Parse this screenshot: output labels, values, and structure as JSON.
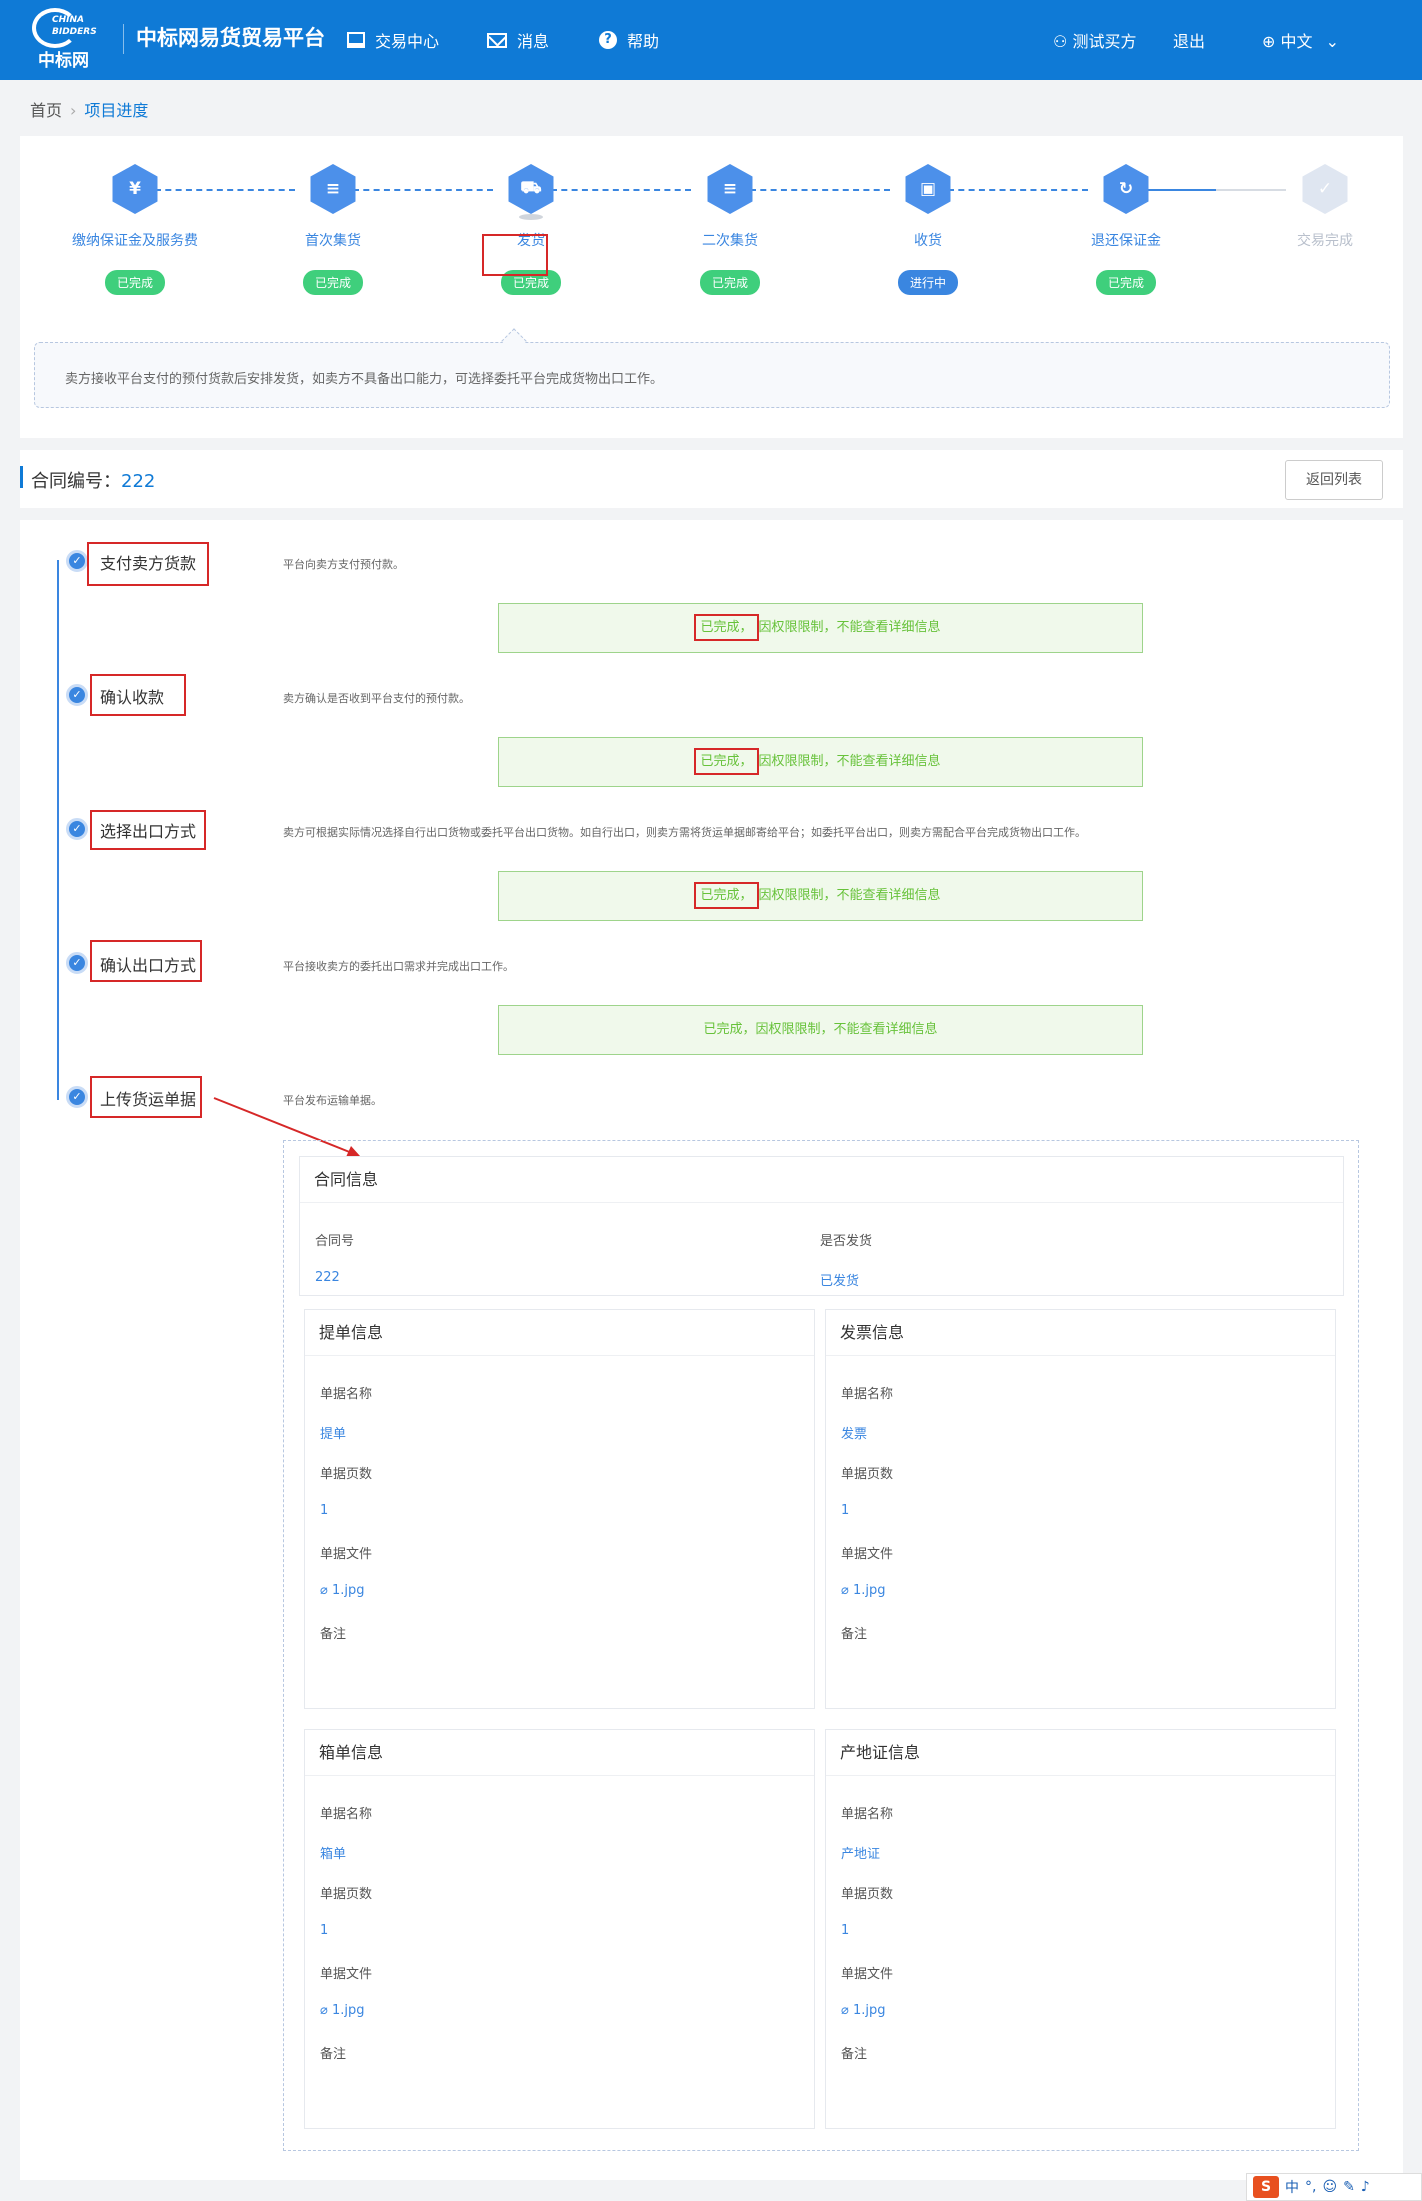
{
  "header": {
    "logo_text_top": "CHINA BIDDERS",
    "logo_text_cn": "中标网",
    "brand": "中标网易货贸易平台",
    "nav": [
      {
        "label": "交易中心",
        "icon": "monitor-icon"
      },
      {
        "label": "消息",
        "icon": "mail-icon"
      },
      {
        "label": "帮助",
        "icon": "help-icon"
      }
    ],
    "user": "测试买方",
    "logout": "退出",
    "lang": "中文"
  },
  "breadcrumb": {
    "home": "首页",
    "current": "项目进度"
  },
  "steps": [
    {
      "label": "缴纳保证金及服务费",
      "status": "已完成",
      "icon_char": "¥",
      "state": "done"
    },
    {
      "label": "首次集货",
      "status": "已完成",
      "icon_char": "≡",
      "state": "done"
    },
    {
      "label": "发货",
      "status": "已完成",
      "icon_char": "⛟",
      "state": "done"
    },
    {
      "label": "二次集货",
      "status": "已完成",
      "icon_char": "≡",
      "state": "done"
    },
    {
      "label": "收货",
      "status": "进行中",
      "icon_char": "▣",
      "state": "active"
    },
    {
      "label": "退还保证金",
      "status": "已完成",
      "icon_char": "↻",
      "state": "done"
    },
    {
      "label": "交易完成",
      "status": "",
      "icon_char": "✓",
      "state": "pending"
    }
  ],
  "step_desc": "卖方接收平台支付的预付货款后安排发货，如卖方不具备出口能力，可选择委托平台完成货物出口工作。",
  "contract": {
    "label": "合同编号：",
    "number": "222",
    "back": "返回列表"
  },
  "timeline": [
    {
      "title": "支付卖方货款",
      "desc": "平台向卖方支付预付款。",
      "done_prefix": "已完成，",
      "done_text": "因权限限制，不能查看详细信息"
    },
    {
      "title": "确认收款",
      "desc": "卖方确认是否收到平台支付的预付款。",
      "done_prefix": "已完成，",
      "done_text": "因权限限制，不能查看详细信息"
    },
    {
      "title": "选择出口方式",
      "desc": "卖方可根据实际情况选择自行出口货物或委托平台出口货物。如自行出口，则卖方需将货运单据邮寄给平台；如委托平台出口，则卖方需配合平台完成货物出口工作。",
      "done_prefix": "已完成，",
      "done_text": "因权限限制，不能查看详细信息"
    },
    {
      "title": "确认出口方式",
      "desc": "平台接收卖方的委托出口需求并完成出口工作。",
      "done_prefix": "已完成，",
      "done_text": "因权限限制，不能查看详细信息"
    },
    {
      "title": "上传货运单据",
      "desc": "平台发布运输单据。"
    }
  ],
  "contract_info": {
    "title": "合同信息",
    "contract_no_label": "合同号",
    "contract_no": "222",
    "shipped_label": "是否发货",
    "shipped": "已发货"
  },
  "doc_cards": [
    {
      "title": "提单信息",
      "name": "提单",
      "pages": "1",
      "file": "1.jpg"
    },
    {
      "title": "发票信息",
      "name": "发票",
      "pages": "1",
      "file": "1.jpg"
    },
    {
      "title": "箱单信息",
      "name": "箱单",
      "pages": "1",
      "file": "1.jpg"
    },
    {
      "title": "产地证信息",
      "name": "产地证",
      "pages": "1",
      "file": "1.jpg"
    }
  ],
  "doc_labels": {
    "name": "单据名称",
    "pages": "单据页数",
    "file": "单据文件",
    "remark": "备注"
  },
  "ime": {
    "logo": "S",
    "lang": "中",
    "punct": "°,"
  }
}
